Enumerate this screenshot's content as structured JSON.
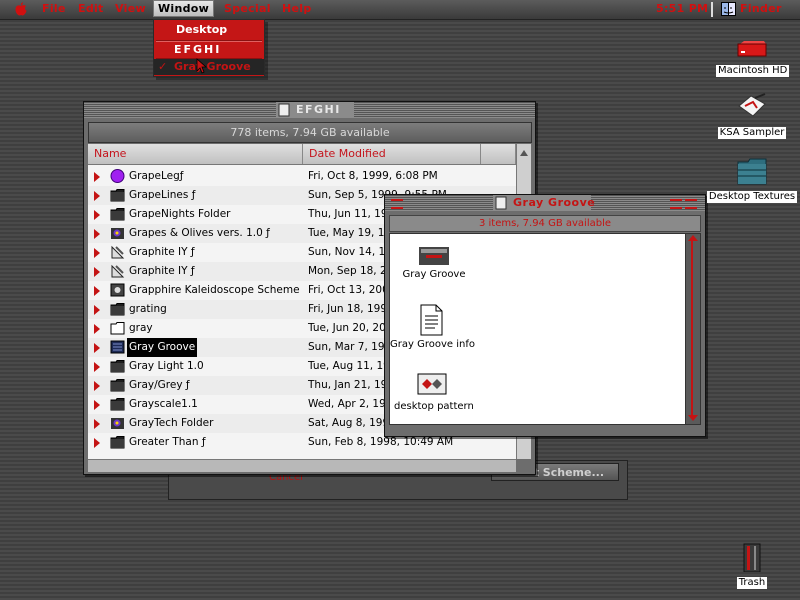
{
  "menubar": {
    "items": [
      "File",
      "Edit",
      "View",
      "Window",
      "Special",
      "Help"
    ],
    "clock": "5:51 PM",
    "app_name": "Finder"
  },
  "window_menu": {
    "items": [
      "Desktop",
      "EFGHI",
      "Gray Groove"
    ],
    "checked_item": "Gray Groove",
    "checkmark": "✓"
  },
  "list_window": {
    "title": "EFGHI",
    "status": "778 items, 7.94 GB available",
    "columns": [
      "Name",
      "Date Modified"
    ],
    "rows": [
      {
        "name": "GrapeLegƒ",
        "date": "Fri, Oct 8, 1999, 6:08 PM",
        "icon": "purple-ball-icon"
      },
      {
        "name": "GrapeLines ƒ",
        "date": "Sun, Sep 5, 1999, 9:55 PM",
        "icon": "folder-icon"
      },
      {
        "name": "GrapeNights Folder",
        "date": "Thu, Jun 11, 1998, 8:13 PM",
        "icon": "folder-icon"
      },
      {
        "name": "Grapes & Olives vers. 1.0 ƒ",
        "date": "Tue, May 19, 1998, 11:07 AM",
        "icon": "app-folder-icon"
      },
      {
        "name": "Graphite IY ƒ",
        "date": "Sun, Nov 14, 1999, 2:24 PM",
        "icon": "graphite-icon"
      },
      {
        "name": "Graphite IY ƒ",
        "date": "Mon, Sep 18, 2000, 1:31 PM",
        "icon": "graphite-icon"
      },
      {
        "name": "Grapphire Kaleidoscope Scheme",
        "date": "Fri, Oct 13, 2000, 9:47 PM",
        "icon": "scheme-icon"
      },
      {
        "name": "grating",
        "date": "Fri, Jun 18, 1999, 7:41 PM",
        "icon": "folder-icon"
      },
      {
        "name": "gray",
        "date": "Tue, Jun 20, 2000, 3:22 PM",
        "icon": "empty-folder-icon"
      },
      {
        "name": "Gray Groove",
        "date": "Sun, Mar 7, 1999, 4:14 PM",
        "icon": "scheme-folder-icon",
        "selected": true
      },
      {
        "name": "Gray Light 1.0",
        "date": "Tue, Aug 11, 1998, 10:02 AM",
        "icon": "folder-icon"
      },
      {
        "name": "Gray/Grey ƒ",
        "date": "Thu, Jan 21, 1999, 8:35 PM",
        "icon": "folder-icon"
      },
      {
        "name": "Grayscale1.1",
        "date": "Wed, Apr 2, 1997, 12:18 PM",
        "icon": "folder-icon"
      },
      {
        "name": "GrayTech Folder",
        "date": "Sat, Aug 8, 1998, 5:50 PM",
        "icon": "app-folder-icon"
      },
      {
        "name": "Greater Than ƒ",
        "date": "Sun, Feb 8, 1998, 10:49 AM",
        "icon": "folder-icon"
      }
    ]
  },
  "back_window": {
    "button_label": "t Scheme...",
    "cancel_label": "Cancel"
  },
  "icon_window": {
    "title": "Gray Groove",
    "status": "3 items, 7.94 GB available",
    "items": [
      {
        "label": "Gray Groove",
        "icon": "scheme-file-icon"
      },
      {
        "label": "Gray Groove info",
        "icon": "document-icon"
      },
      {
        "label": "desktop pattern",
        "icon": "pattern-file-icon"
      }
    ]
  },
  "desktop": {
    "icons": [
      {
        "label": "Macintosh HD",
        "icon": "hard-drive-icon"
      },
      {
        "label": "KSA Sampler",
        "icon": "cd-icon"
      },
      {
        "label": "Desktop Textures",
        "icon": "folder-icon"
      },
      {
        "label": "Trash",
        "icon": "trash-icon"
      }
    ]
  }
}
